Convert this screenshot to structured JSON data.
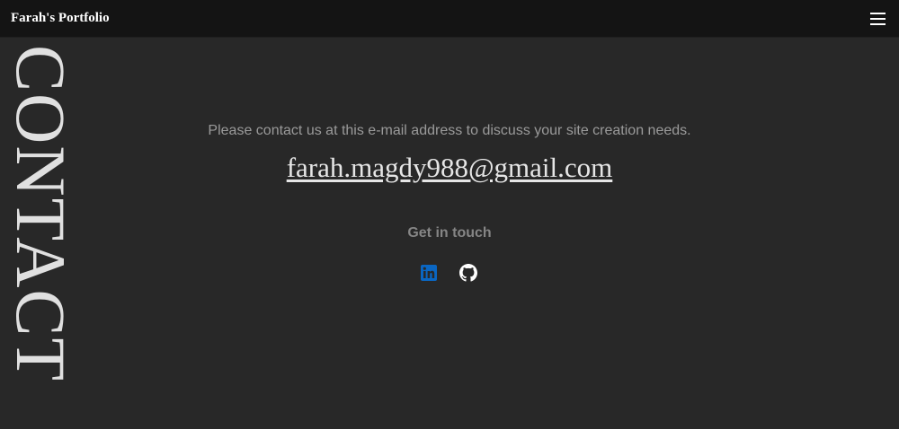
{
  "header": {
    "brand": "Farah's Portfolio",
    "menu_icon": "hamburger-menu-icon"
  },
  "side_heading": "CONTACT",
  "contact": {
    "intro": "Please contact us at this e-mail address to discuss your site creation needs.",
    "email": "farah.magdy988@gmail.com"
  },
  "social": {
    "heading": "Get in touch",
    "links": [
      {
        "icon": "linkedin-icon",
        "color": "#0a66c2"
      },
      {
        "icon": "github-icon",
        "color": "#ffffff"
      }
    ]
  },
  "colors": {
    "background": "#282828",
    "topbar": "#141414",
    "text_muted": "#9a9a9a",
    "linkedin": "#0a66c2"
  }
}
